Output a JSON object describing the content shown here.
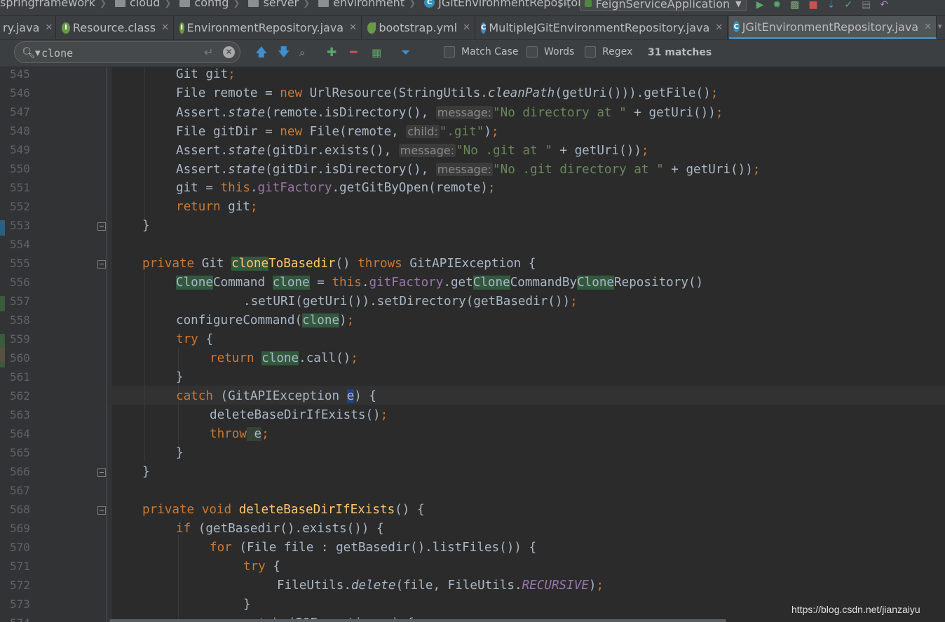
{
  "breadcrumb": [
    "springframework",
    "cloud",
    "config",
    "server",
    "environment",
    "JGitEnvironmentRepository"
  ],
  "run_config": "FeignServiceApplication",
  "tabs": [
    {
      "label": "ry.java",
      "icon": "none",
      "active": false
    },
    {
      "label": "Resource.class",
      "icon": "interface-icon",
      "active": false
    },
    {
      "label": "EnvironmentRepository.java",
      "icon": "interface-icon",
      "active": false
    },
    {
      "label": "bootstrap.yml",
      "icon": "yml-icon",
      "active": false
    },
    {
      "label": "MultipleJGitEnvironmentRepository.java",
      "icon": "class-icon",
      "active": false
    },
    {
      "label": "JGitEnvironmentRepository.java",
      "icon": "class-icon",
      "active": true
    }
  ],
  "find": {
    "query": "clone",
    "match_case": "Match Case",
    "words": "Words",
    "regex": "Regex",
    "match_count": "31 matches",
    "match_case_checked": false,
    "words_checked": false,
    "regex_checked": false
  },
  "line_numbers": [
    "545",
    "546",
    "547",
    "548",
    "549",
    "550",
    "551",
    "552",
    "553",
    "554",
    "555",
    "556",
    "557",
    "558",
    "559",
    "560",
    "561",
    "562",
    "563",
    "564",
    "565",
    "566",
    "567",
    "568",
    "569",
    "570",
    "571",
    "572",
    "573",
    "574"
  ],
  "code": {
    "l545_a": "Git git",
    "l546_a": "File remote = ",
    "l546_new": "new",
    "l546_b": " UrlResource(StringUtils.",
    "l546_m": "cleanPath",
    "l546_c": "(getUri())).getFile()",
    "l547_a": "Assert.",
    "l547_m": "state",
    "l547_b": "(remote.isDirectory(), ",
    "l547_hint": "message:",
    "l547_s": "\"No directory at \"",
    "l547_c": " + getUri())",
    "l548_a": "File gitDir = ",
    "l548_new": "new",
    "l548_b": " File(remote, ",
    "l548_hint": "child:",
    "l548_s": "\".git\"",
    "l548_c": ")",
    "l549_a": "Assert.",
    "l549_m": "state",
    "l549_b": "(gitDir.exists(), ",
    "l549_hint": "message:",
    "l549_s": "\"No .git at \"",
    "l549_c": " + getUri())",
    "l550_a": "Assert.",
    "l550_m": "state",
    "l550_b": "(gitDir.isDirectory(), ",
    "l550_hint": "message:",
    "l550_s": "\"No .git directory at \"",
    "l550_c": " + getUri())",
    "l551_a": "git = ",
    "l551_this": "this",
    "l551_f": "gitFactory",
    "l551_b": ".getGitByOpen(remote)",
    "l552_kw": "return",
    "l552_a": " git",
    "l553": "}",
    "l555_kw": "private",
    "l555_a": " Git ",
    "l555_hl": "clone",
    "l555_fn": "ToBasedir",
    "l555_b": "() ",
    "l555_kw2": "throws",
    "l555_c": " GitAPIException {",
    "l556_hl1": "Clone",
    "l556_a": "Command ",
    "l556_hl2": "clone",
    "l556_b": " = ",
    "l556_this": "this",
    "l556_f": "gitFactory",
    "l556_c": ".get",
    "l556_hl3": "Clone",
    "l556_d": "CommandBy",
    "l556_hl4": "Clone",
    "l556_e": "Repository()",
    "l557_a": ".setURI(getUri()).setDirectory(getBasedir())",
    "l558_a": "configureCommand(",
    "l558_hl": "clone",
    "l558_b": ")",
    "l559_kw": "try",
    "l559_a": " {",
    "l560_kw": "return",
    "l560_hl": "clone",
    "l560_a": ".call()",
    "l561": "}",
    "l562_kw": "catch",
    "l562_a": " (GitAPIException ",
    "l562_hl": "e",
    "l562_b": ") {",
    "l563_a": "deleteBaseDirIfExists()",
    "l564_kw": "throw",
    "l564_a": " e",
    "l565": "}",
    "l566": "}",
    "l568_kw": "private",
    "l568_kw2": "void",
    "l568_fn": "deleteBaseDirIfExists",
    "l568_a": "() {",
    "l569_kw": "if",
    "l569_a": " (getBasedir().exists()) {",
    "l570_kw": "for",
    "l570_a": " (File file : getBasedir().listFiles()) {",
    "l571_kw": "try",
    "l571_a": " {",
    "l572_a": "FileUtils.",
    "l572_m": "delete",
    "l572_b": "(file, FileUtils.",
    "l572_c": "RECURSIVE",
    "l572_d": ")",
    "l573": "}",
    "l574_kw": "catch",
    "l574_a": " (IOException e) {",
    "semi": ";",
    "dot": ".",
    "sp": " "
  },
  "watermark": "https://blog.csdn.net/jianzaiyu",
  "colors": {
    "background": "#2b2b2b",
    "keyword": "#cc7832",
    "string": "#6a8759",
    "field": "#9876aa",
    "method_decl": "#ffc66d",
    "search_highlight": "#32593d",
    "active_tab_underline": "#4a88c7"
  }
}
